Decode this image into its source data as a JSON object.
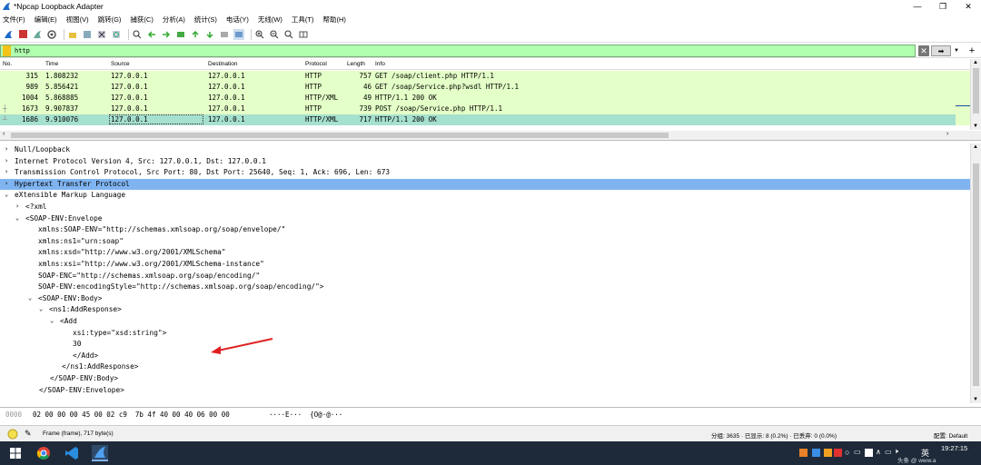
{
  "window": {
    "title": "*Npcap Loopback Adapter"
  },
  "menu": [
    "文件(F)",
    "编辑(E)",
    "视图(V)",
    "跳转(G)",
    "捕获(C)",
    "分析(A)",
    "统计(S)",
    "电话(Y)",
    "无线(W)",
    "工具(T)",
    "帮助(H)"
  ],
  "filter": {
    "value": "http"
  },
  "packet_list": {
    "columns": [
      "No.",
      "Time",
      "Source",
      "Destination",
      "Protocol",
      "Length",
      "Info"
    ],
    "rows": [
      {
        "no": "315",
        "time": "1.808232",
        "src": "127.0.0.1",
        "dst": "127.0.0.1",
        "proto": "HTTP",
        "len": "757",
        "info": "GET /soap/client.php HTTP/1.1"
      },
      {
        "no": "989",
        "time": "5.856421",
        "src": "127.0.0.1",
        "dst": "127.0.0.1",
        "proto": "HTTP",
        "len": "46",
        "info": "GET /soap/Service.php?wsdl HTTP/1.1"
      },
      {
        "no": "1004",
        "time": "5.868885",
        "src": "127.0.0.1",
        "dst": "127.0.0.1",
        "proto": "HTTP/XML",
        "len": "49",
        "info": "HTTP/1.1 200 OK"
      },
      {
        "no": "1673",
        "time": "9.907837",
        "src": "127.0.0.1",
        "dst": "127.0.0.1",
        "proto": "HTTP",
        "len": "739",
        "info": "POST /soap/Service.php HTTP/1.1"
      },
      {
        "no": "1686",
        "time": "9.910076",
        "src": "127.0.0.1",
        "dst": "127.0.0.1",
        "proto": "HTTP/XML",
        "len": "717",
        "info": "HTTP/1.1 200 OK"
      }
    ]
  },
  "details": [
    {
      "arrow": ">",
      "text": "Null/Loopback"
    },
    {
      "arrow": ">",
      "text": "Internet Protocol Version 4, Src: 127.0.0.1, Dst: 127.0.0.1"
    },
    {
      "arrow": ">",
      "text": "Transmission Control Protocol, Src Port: 80, Dst Port: 25640, Seq: 1, Ack: 696, Len: 673"
    },
    {
      "arrow": ">",
      "text": "Hypertext Transfer Protocol"
    },
    {
      "arrow": "v",
      "text": "eXtensible Markup Language"
    },
    {
      "arrow": ">",
      "text": "<?xml"
    },
    {
      "arrow": "v",
      "text": "<SOAP-ENV:Envelope"
    },
    {
      "arrow": "",
      "text": "xmlns:SOAP-ENV=\"http://schemas.xmlsoap.org/soap/envelope/\""
    },
    {
      "arrow": "",
      "text": "xmlns:ns1=\"urn:soap\""
    },
    {
      "arrow": "",
      "text": "xmlns:xsd=\"http://www.w3.org/2001/XMLSchema\""
    },
    {
      "arrow": "",
      "text": "xmlns:xsi=\"http://www.w3.org/2001/XMLSchema-instance\""
    },
    {
      "arrow": "",
      "text": "SOAP-ENC=\"http://schemas.xmlsoap.org/soap/encoding/\""
    },
    {
      "arrow": "",
      "text": "SOAP-ENV:encodingStyle=\"http://schemas.xmlsoap.org/soap/encoding/\">"
    },
    {
      "arrow": "v",
      "text": "<SOAP-ENV:Body>"
    },
    {
      "arrow": "v",
      "text": "<ns1:AddResponse>"
    },
    {
      "arrow": "v",
      "text": "<Add"
    },
    {
      "arrow": "",
      "text": "xsi:type=\"xsd:string\">"
    },
    {
      "arrow": "",
      "text": "30"
    },
    {
      "arrow": "",
      "text": "</Add>"
    },
    {
      "arrow": "",
      "text": "</ns1:AddResponse>"
    },
    {
      "arrow": "",
      "text": "</SOAP-ENV:Body>"
    },
    {
      "arrow": "",
      "text": "</SOAP-ENV:Envelope>"
    }
  ],
  "hex": {
    "offset": "0000",
    "bytes": "02 00 00 00 45 00 02 c9  7b 4f 40 00 40 06 00 00",
    "ascii": "····E···  {O@·@···"
  },
  "status": {
    "frame": "Frame (frame), 717 byte(s)",
    "stats": "分组: 3635 · 已显示: 8 (0.2%) · 已丢弃: 0 (0.0%)",
    "profile": "配置: Default"
  },
  "taskbar": {
    "time": "19:27:15",
    "ime": "英",
    "watermark": "头条 @ www.a"
  },
  "colors": {
    "http_row": "#e4ffc7",
    "selected_row": "#a6e0cf",
    "filter_ok": "#afffaf",
    "detail_highlight": "#7fb4f0",
    "annotation_arrow": "#e02020"
  }
}
